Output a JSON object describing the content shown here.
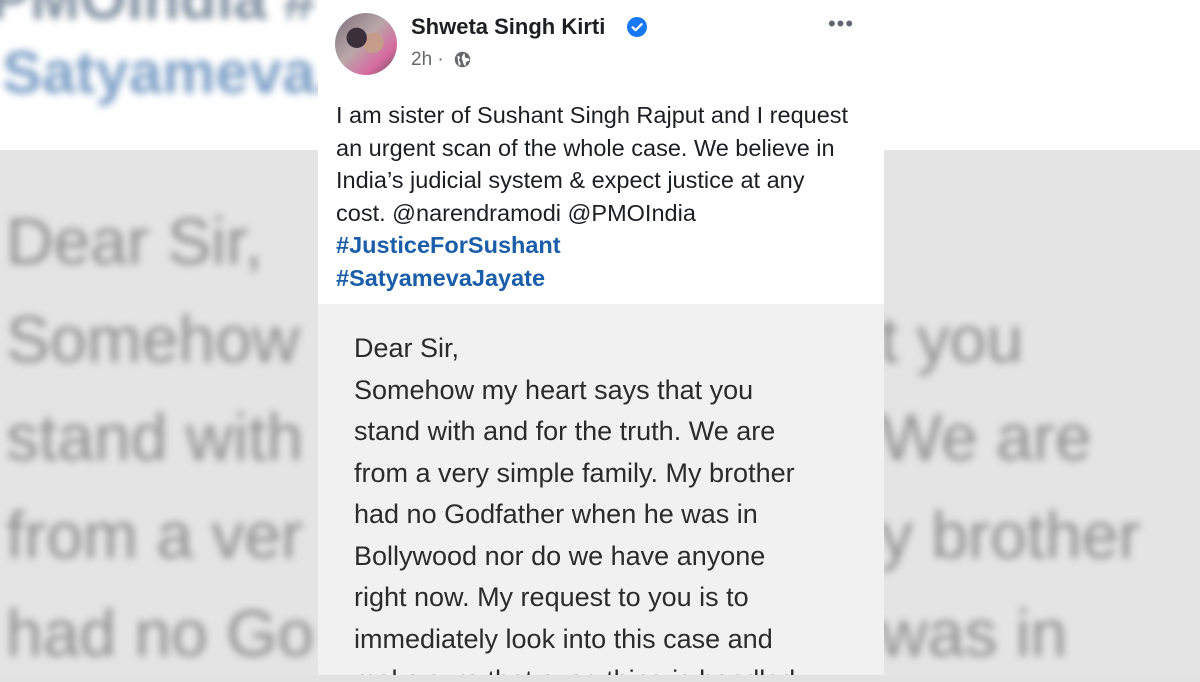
{
  "background": {
    "top_lines": [
      "PMOIndia #",
      "Satyameva."
    ],
    "bottom_lines": [
      {
        "left": "Dear Sir,",
        "right": ""
      },
      {
        "left": "Somehow",
        "right": "t you"
      },
      {
        "left": "stand with",
        "right": "We are"
      },
      {
        "left": "from a ver",
        "right": "y brother"
      },
      {
        "left": "had no Go",
        "right": "was in"
      }
    ]
  },
  "post": {
    "author": "Shweta Singh Kirti",
    "time": "2h",
    "separator": "·",
    "text": "I am sister of Sushant Singh Rajput and I request an urgent scan of the whole case. We believe in India’s judicial system & expect justice at any cost. @narendramodi @PMOIndia ",
    "hashtag_1": "#JusticeForSushant",
    "hashtag_2": "#SatyamevaJayate",
    "icons": {
      "verified": "verified-badge-icon",
      "audience": "globe-icon",
      "menu": "more-options-icon"
    },
    "colors": {
      "hashtag": "#1a5ea9",
      "verified": "#1877f2"
    }
  },
  "letter": {
    "lines": [
      "Dear Sir,",
      "Somehow my heart says that you",
      "stand with and for the truth. We are",
      "from a very simple family. My brother",
      "had no Godfather when he was in",
      "Bollywood nor do we have anyone",
      "right now. My request to you is to",
      "immediately look into this case and",
      "make sure that everything is handled"
    ]
  }
}
